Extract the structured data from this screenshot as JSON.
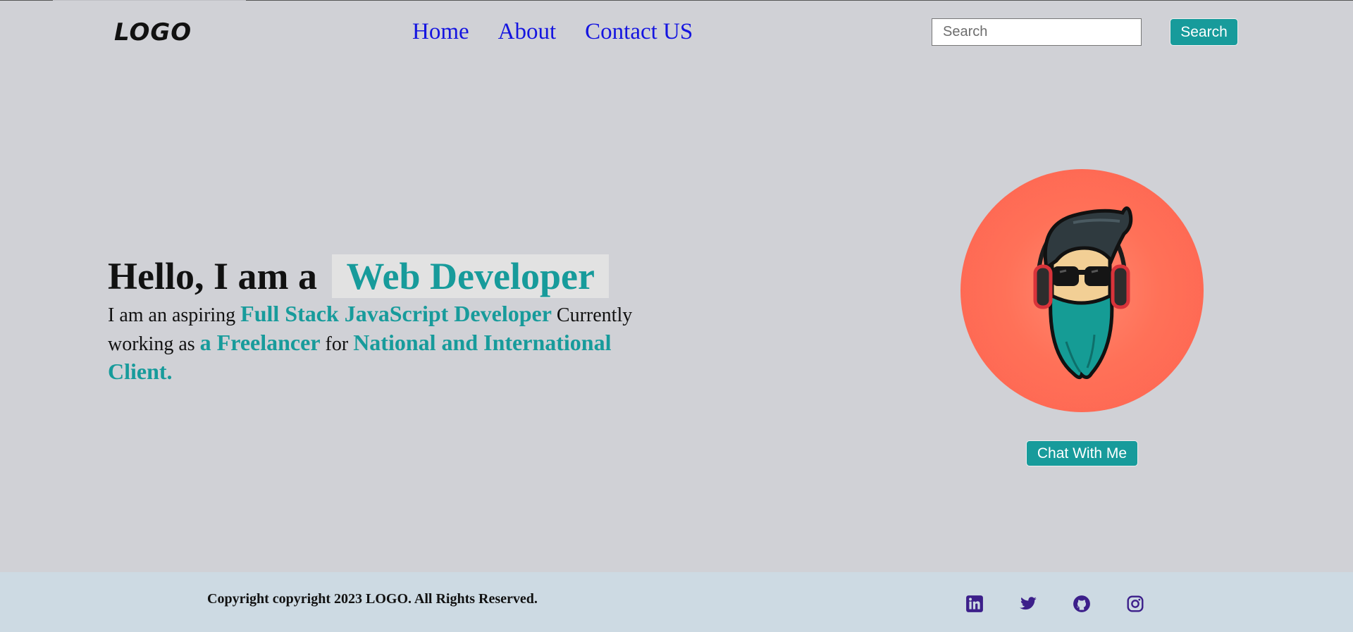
{
  "header": {
    "logo": "LOGO",
    "nav": [
      {
        "label": "Home"
      },
      {
        "label": "About"
      },
      {
        "label": "Contact US"
      }
    ],
    "search": {
      "placeholder": "Search",
      "value": "",
      "button_label": "Search"
    }
  },
  "hero": {
    "title_prefix": "Hello, I am a",
    "title_role": "Web Developer",
    "intro": {
      "t1": "I am an aspiring ",
      "h1": "Full Stack JavaScript Developer",
      "t2": " Currently working as ",
      "h2": "a Freelancer",
      "t3": " for ",
      "h3": "National and International Client."
    }
  },
  "profile": {
    "avatar_icon": "bearded-man-headphones-icon",
    "chat_button": "Chat With Me"
  },
  "footer": {
    "copyright": "Copyright copyright 2023 LOGO. All Rights Reserved.",
    "socials": [
      "linkedin-icon",
      "twitter-icon",
      "github-icon",
      "instagram-icon"
    ]
  },
  "colors": {
    "background": "#d0d1d6",
    "accent": "#179b9b",
    "nav_link": "#1515e0",
    "avatar_bg": "#fe6250",
    "footer_bg": "#cddae3",
    "social_icon": "#3c1f8a"
  }
}
